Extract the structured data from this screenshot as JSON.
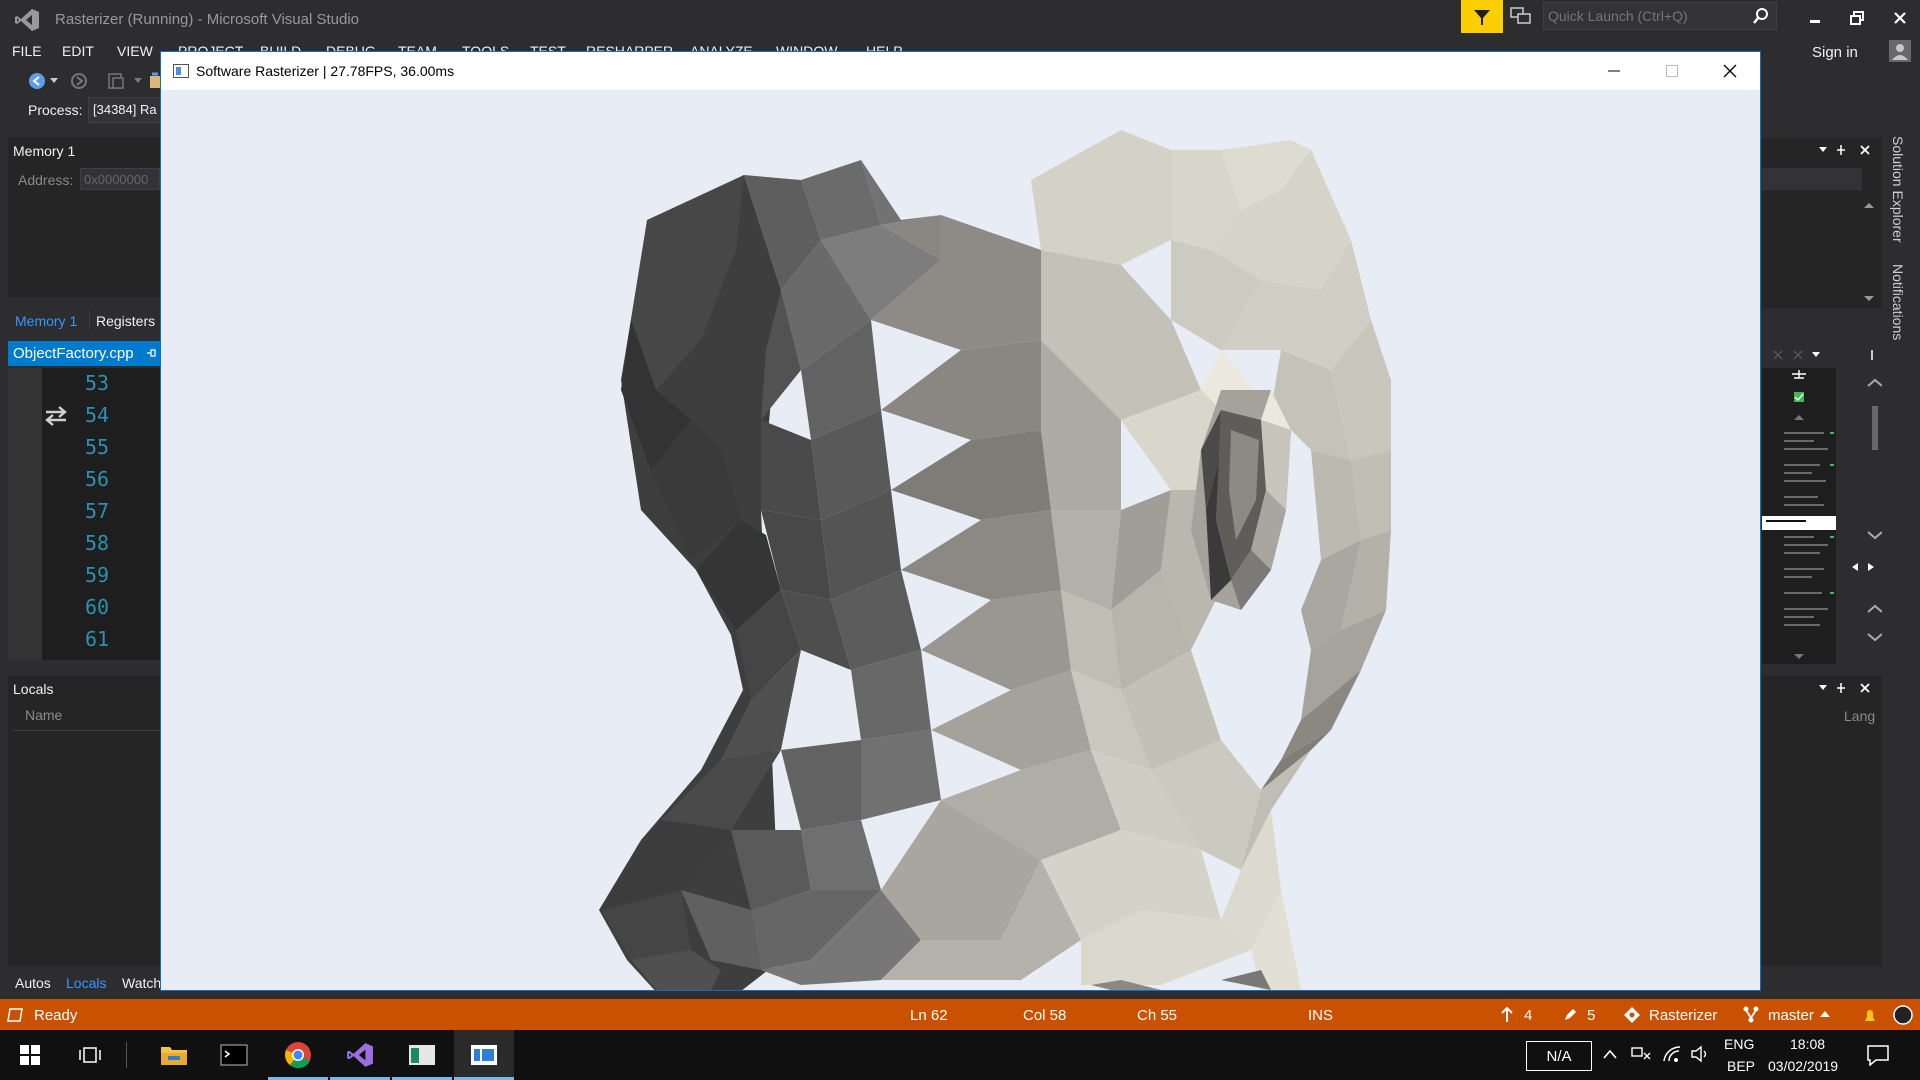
{
  "vs": {
    "window_title": "Rasterizer (Running) - Microsoft Visual Studio",
    "quick_launch_placeholder": "Quick Launch (Ctrl+Q)",
    "menu": [
      "FILE",
      "EDIT",
      "VIEW",
      "PROJECT",
      "BUILD",
      "DEBUG",
      "TEAM",
      "TOOLS",
      "TEST",
      "RESHARPER",
      "ANALYZE",
      "WINDOW",
      "HELP"
    ],
    "sign_in": "Sign in",
    "process_label": "Process:",
    "process_value": "[34384] Ra",
    "accent_color": "#007acc",
    "filter_color": "#fbcf02"
  },
  "memory_panel": {
    "title": "Memory 1",
    "address_label": "Address:",
    "address_value": "0x0000000"
  },
  "debug_tabs": [
    "Memory 1",
    "Registers"
  ],
  "editor": {
    "file_tab": "ObjectFactory.cpp",
    "line_numbers": [
      "53",
      "54",
      "55",
      "56",
      "57",
      "58",
      "59",
      "60",
      "61"
    ]
  },
  "locals_panel": {
    "title": "Locals",
    "column_name": "Name",
    "column_lang": "Lang"
  },
  "bottom_tabs": [
    "Autos",
    "Locals",
    "Watch"
  ],
  "side_labels": [
    "Solution Explorer",
    "Notifications"
  ],
  "status_bar": {
    "ready": "Ready",
    "line": "Ln 62",
    "col": "Col 58",
    "ch": "Ch 55",
    "mode": "INS",
    "up_count": "4",
    "pending_count": "5",
    "project": "Rasterizer",
    "branch": "master",
    "color": "#ca5100"
  },
  "rasterizer": {
    "title": "Software Rasterizer | 27.78FPS, 36.00ms",
    "background": "#e8edf5"
  },
  "taskbar": {
    "tray_na": "N/A",
    "lang_line1": "ENG",
    "lang_line2": "BEP",
    "time": "18:08",
    "date": "03/02/2019"
  }
}
